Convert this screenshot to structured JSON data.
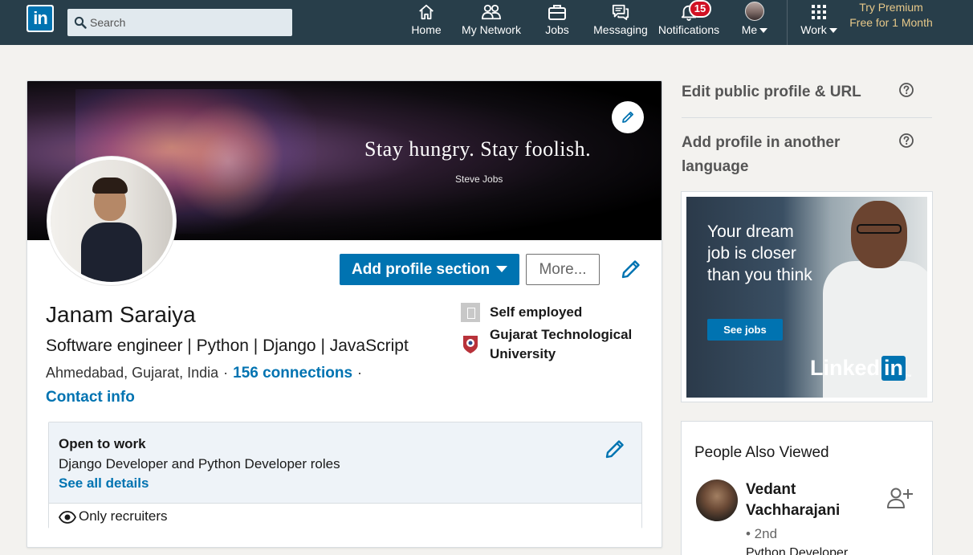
{
  "nav": {
    "logo_text": "in",
    "search_placeholder": "Search",
    "items": [
      {
        "label": "Home",
        "icon": "home-icon"
      },
      {
        "label": "My Network",
        "icon": "network-icon"
      },
      {
        "label": "Jobs",
        "icon": "briefcase-icon"
      },
      {
        "label": "Messaging",
        "icon": "chat-icon"
      },
      {
        "label": "Notifications",
        "icon": "bell-icon",
        "badge": "15"
      },
      {
        "label": "Me",
        "icon": "avatar"
      },
      {
        "label": "Work",
        "icon": "grid-icon"
      }
    ],
    "premium_label": "Try Premium Free for 1 Month"
  },
  "banner": {
    "quote": "Stay hungry. Stay foolish.",
    "author": "Steve Jobs"
  },
  "intro": {
    "add_section_label": "Add profile section",
    "more_label": "More...",
    "name": "Janam Saraiya",
    "headline": "Software engineer | Python | Django | JavaScript",
    "location": "Ahmedabad, Gujarat, India",
    "connections": "156 connections",
    "contact_info": "Contact info",
    "experience": [
      {
        "label": "Self employed"
      },
      {
        "label": "Gujarat Technological University"
      }
    ]
  },
  "open_to_work": {
    "title": "Open to work",
    "roles": "Django Developer and Python Developer roles",
    "details_link": "See all details",
    "visibility": "Only recruiters"
  },
  "rail": {
    "edit_public_profile": "Edit public profile & URL",
    "add_language_profile": "Add profile in another language",
    "ad": {
      "text": "Your dream job is closer than you think",
      "button": "See jobs",
      "brand": "Linked",
      "brand_in": "in"
    },
    "people_also_viewed": {
      "title": "People Also Viewed",
      "person_name": "Vedant Vachharajani",
      "degree": "• 2nd",
      "subtitle": "Python Developer"
    }
  },
  "colors": {
    "nav_bg": "#283e4a",
    "primary_blue": "#0073b1",
    "premium_gold": "#e7c889",
    "badge_red": "#d11124",
    "page_bg": "#f3f2ef"
  }
}
